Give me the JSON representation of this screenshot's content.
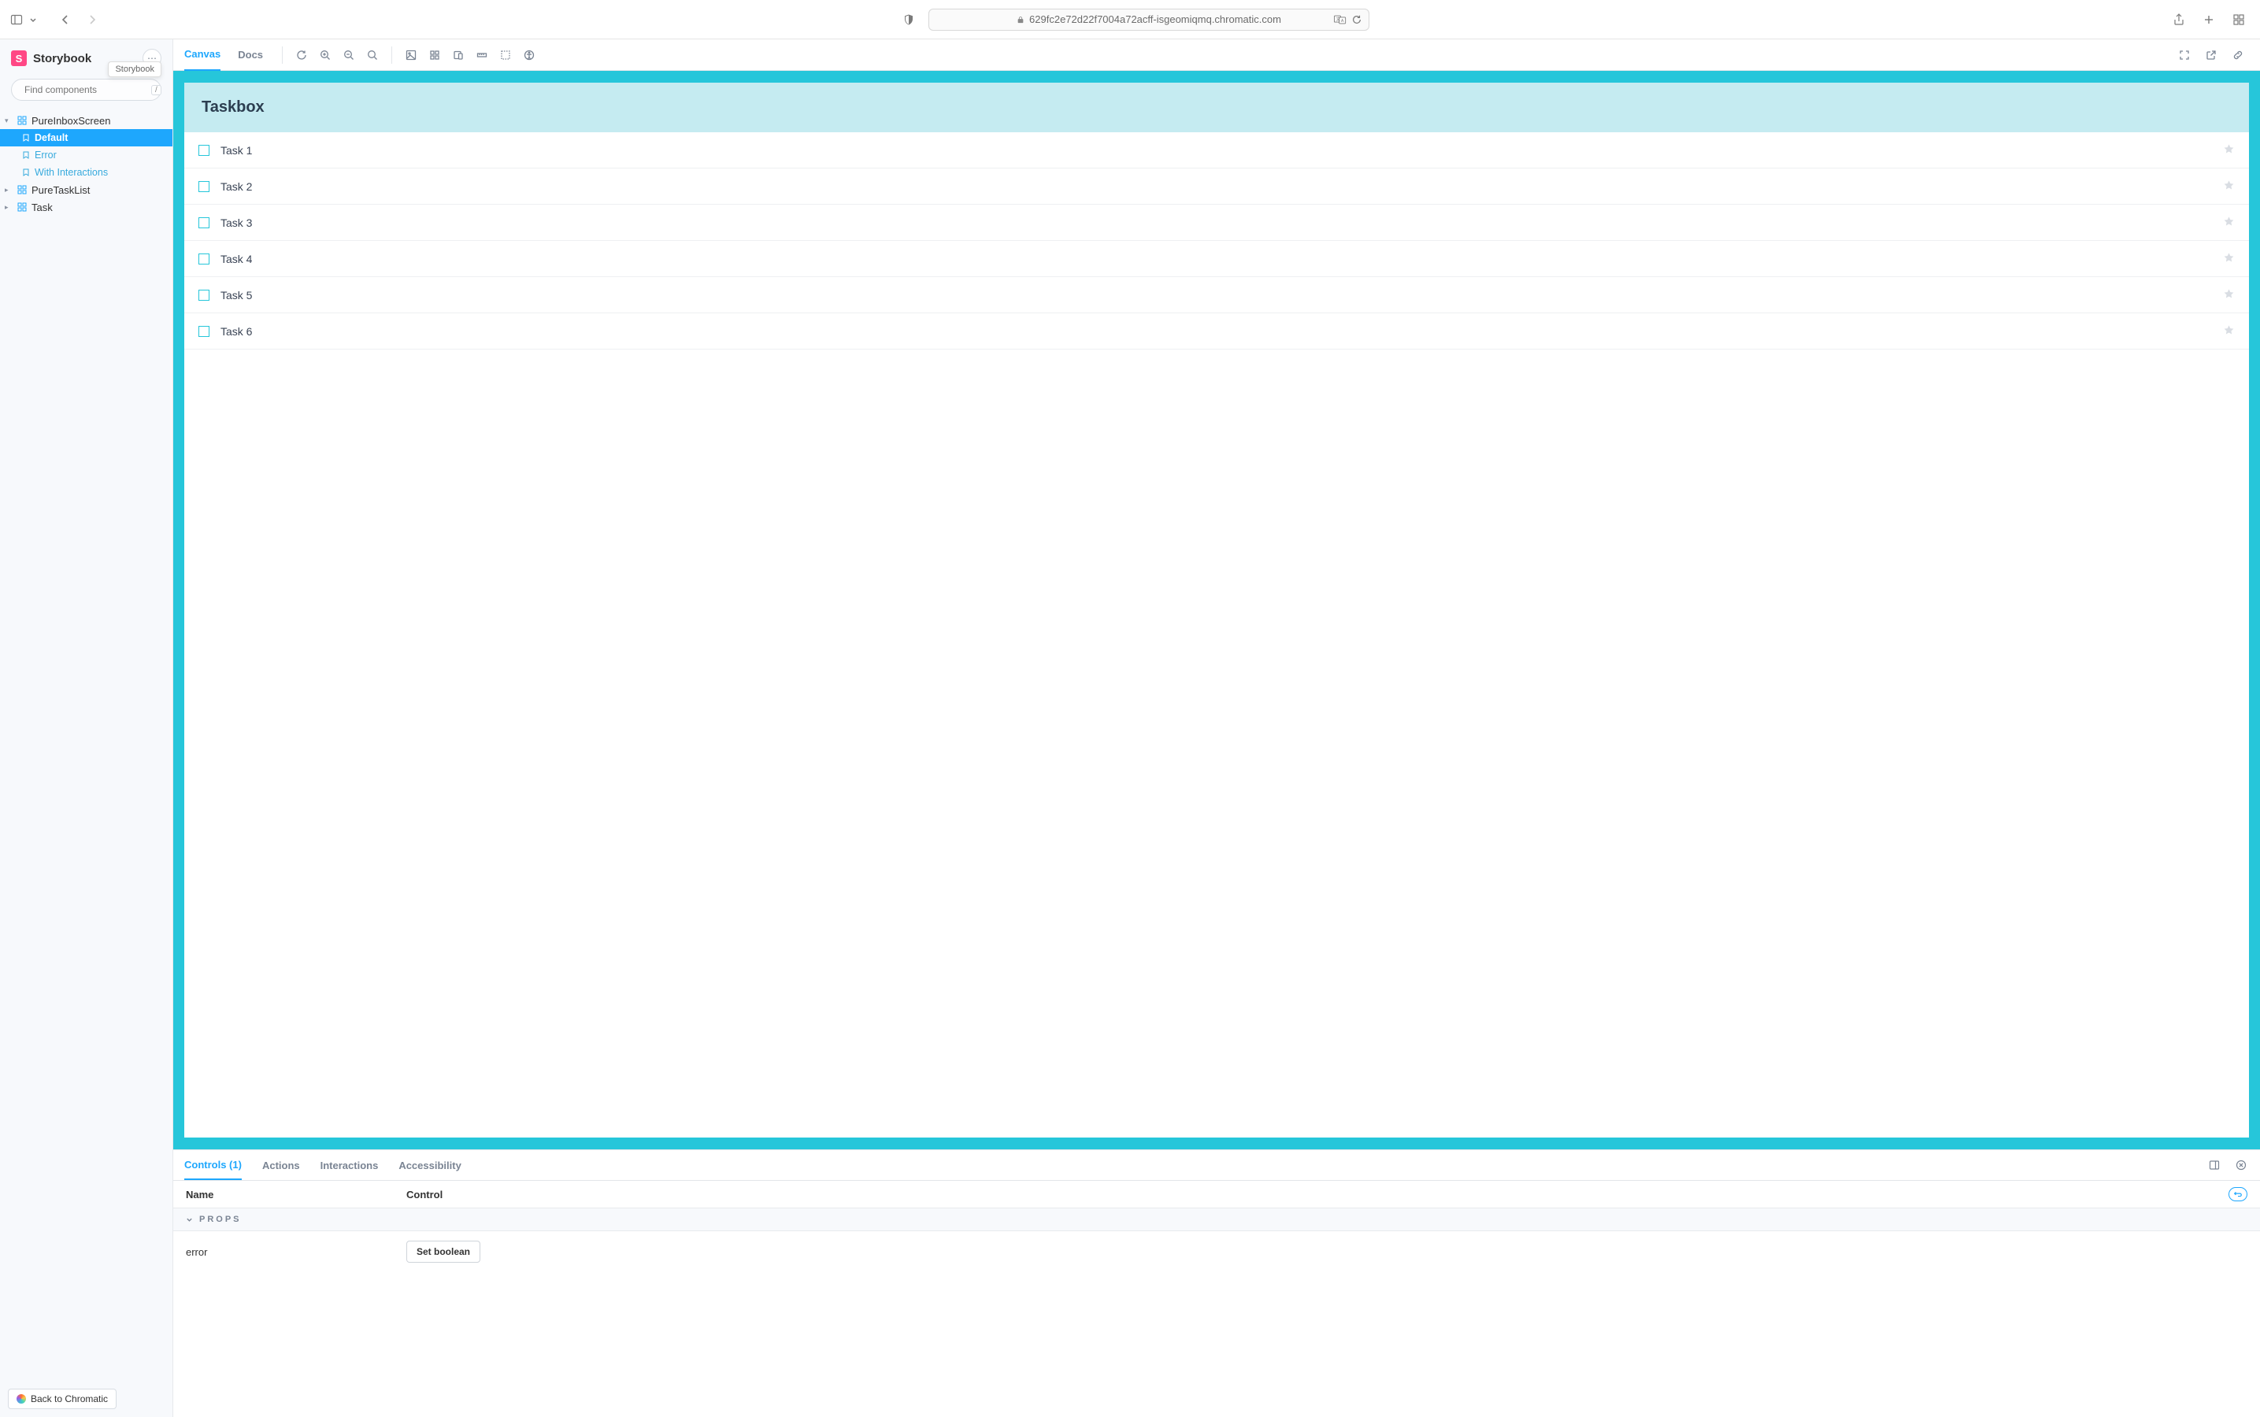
{
  "chrome": {
    "url_host": "629fc2e72d22f7004a72acff-isgeomiqmq.chromatic.com"
  },
  "sidebar": {
    "brand": "Storybook",
    "logo_letter": "S",
    "tooltip": "Storybook",
    "search_placeholder": "Find components",
    "kbd": "/",
    "tree": [
      {
        "label": "PureInboxScreen",
        "expanded": true,
        "children": [
          {
            "label": "Default",
            "selected": true
          },
          {
            "label": "Error"
          },
          {
            "label": "With Interactions"
          }
        ]
      },
      {
        "label": "PureTaskList",
        "expanded": false
      },
      {
        "label": "Task",
        "expanded": false
      }
    ],
    "footer_btn": "Back to Chromatic"
  },
  "toolbar": {
    "tabs": [
      {
        "label": "Canvas",
        "active": true
      },
      {
        "label": "Docs"
      }
    ]
  },
  "taskbox": {
    "title": "Taskbox",
    "tasks": [
      {
        "title": "Task 1"
      },
      {
        "title": "Task 2"
      },
      {
        "title": "Task 3"
      },
      {
        "title": "Task 4"
      },
      {
        "title": "Task 5"
      },
      {
        "title": "Task 6"
      }
    ]
  },
  "addons": {
    "tabs": [
      {
        "label": "Controls (1)",
        "active": true
      },
      {
        "label": "Actions"
      },
      {
        "label": "Interactions"
      },
      {
        "label": "Accessibility"
      }
    ],
    "header": {
      "name": "Name",
      "control": "Control"
    },
    "section": "PROPS",
    "rows": [
      {
        "name": "error",
        "button": "Set boolean"
      }
    ]
  }
}
